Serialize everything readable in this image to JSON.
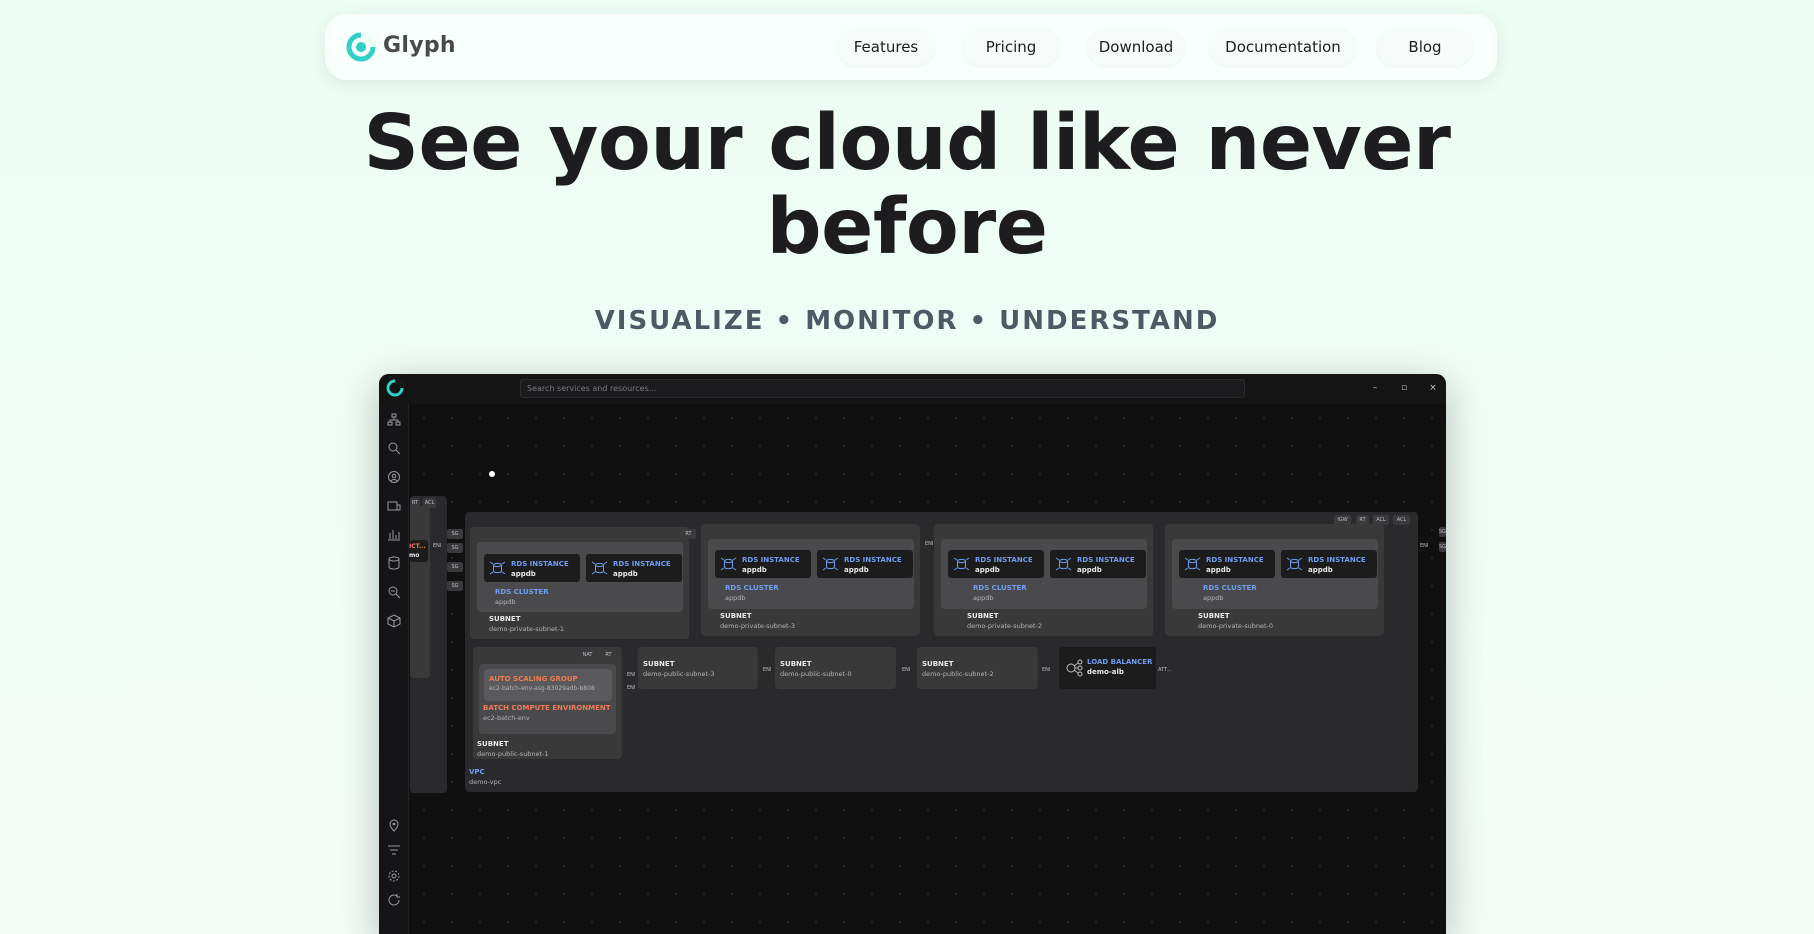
{
  "nav": {
    "brand": "Glyph",
    "links": [
      "Features",
      "Pricing",
      "Download",
      "Documentation",
      "Blog"
    ]
  },
  "hero": {
    "title": "See your cloud like never before",
    "subtitle": "VISUALIZE • MONITOR • UNDERSTAND"
  },
  "app": {
    "search_placeholder": "Search services and resources...",
    "window_controls": [
      "–",
      "▫",
      "×"
    ],
    "accent": "#2fd0c6",
    "left_stub": {
      "title": "ICT...",
      "value": "mo"
    },
    "tags": {
      "rt": "RT",
      "acl": "ACL",
      "igw": "IGW",
      "sg": "SG",
      "eni": "ENI",
      "nat": "NAT",
      "att": "ATT..."
    },
    "rds_instance_label": "RDS INSTANCE",
    "rds_instance_value": "appdb",
    "rds_cluster_label": "RDS CLUSTER",
    "rds_cluster_label_alt": "RDS CLUSTER",
    "rds_cluster_value": "appdb",
    "subnet_label": "SUBNET",
    "private_subnets": [
      "demo-private-subnet-1",
      "demo-private-subnet-3",
      "demo-private-subnet-2",
      "demo-private-subnet-0"
    ],
    "public_subnets": [
      "demo-public-subnet-1",
      "demo-public-subnet-3",
      "demo-public-subnet-0",
      "demo-public-subnet-2"
    ],
    "asg_label": "AUTO SCALING GROUP",
    "asg_value": "ec2-batch-env-asg-83029adb-b808",
    "batch_label": "BATCH COMPUTE ENVIRONMENT",
    "batch_value": "ec2-batch-env",
    "lb_label": "LOAD BALANCER",
    "lb_value": "demo-alb",
    "vpc_label": "VPC",
    "vpc_value": "demo-vpc"
  }
}
